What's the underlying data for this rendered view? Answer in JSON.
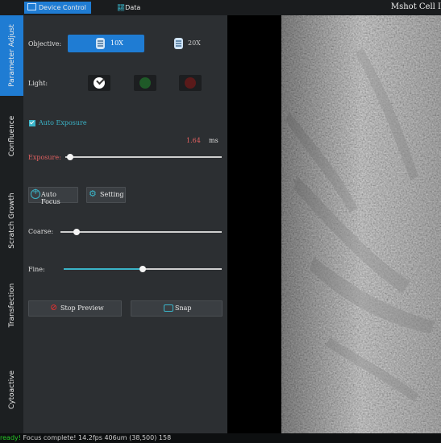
{
  "tabs": {
    "device_control": "Device Control",
    "data": "Data"
  },
  "app_title": "Mshot Cell I",
  "side_tabs": [
    "Parameter Adjust",
    "Confluence",
    "Scratch Growth",
    "Transfection",
    "Cytoactive"
  ],
  "panel": {
    "objective_label": "Objective:",
    "objectives": [
      "10X",
      "20X"
    ],
    "selected_objective": "10X",
    "light_label": "Light:",
    "lights": [
      {
        "color": "#ffffff",
        "checked": true
      },
      {
        "color": "#1f5a28",
        "checked": false
      },
      {
        "color": "#5a1a1a",
        "checked": false
      }
    ],
    "auto_exposure_label": "Auto Exposure",
    "auto_exposure_checked": true,
    "exposure_value": "1.64",
    "exposure_unit": "ms",
    "exposure_label": "Exposure:",
    "exposure_level": 0.03,
    "auto_focus_label": "Auto Focus",
    "setting_label": "Setting",
    "coarse_label": "Coarse:",
    "coarse_level": 0.1,
    "fine_label": "Fine:",
    "fine_level": 0.5,
    "stop_preview_label": "Stop Preview",
    "snap_label": "Snap"
  },
  "status": {
    "ready": "ready!",
    "message": "Focus complete!  14.2fps  406um (38,500) 158"
  },
  "colors": {
    "accent": "#1f7cd3",
    "teal": "#3ab4c8",
    "exposure_red": "#e06060"
  }
}
